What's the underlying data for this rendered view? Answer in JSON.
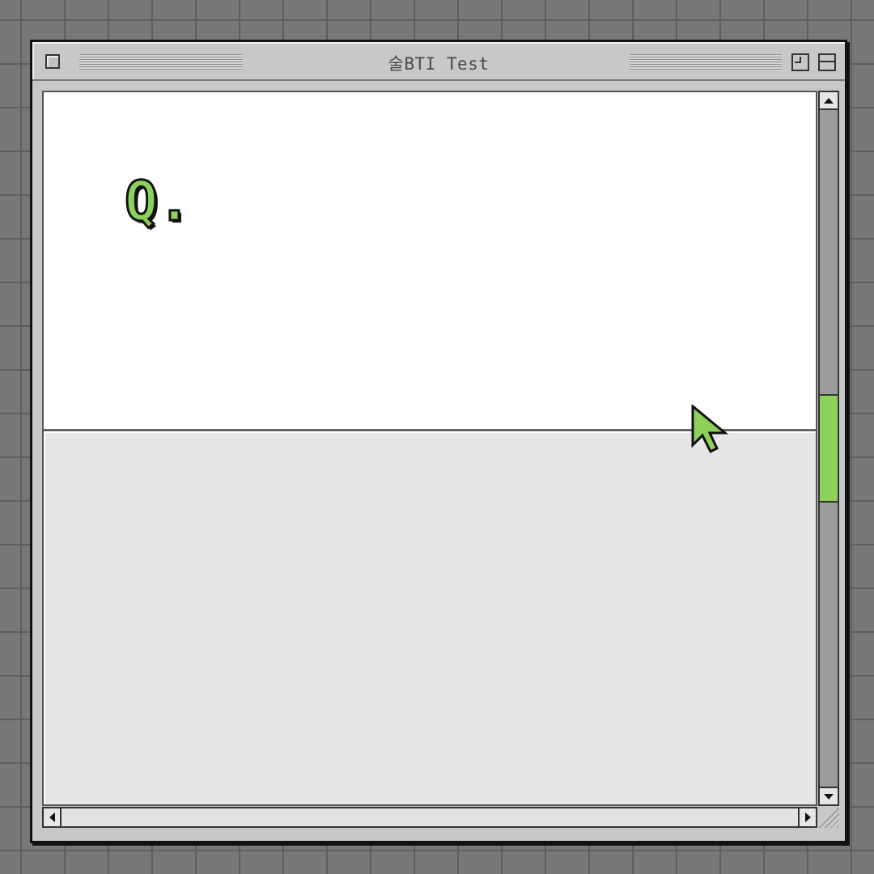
{
  "window": {
    "title": "술BTI Test"
  },
  "question": {
    "label": "Q."
  },
  "answer": {},
  "scrollbar": {
    "vertical_position": 0.5
  },
  "colors": {
    "accent": "#8ed15a",
    "desktop": "#787878",
    "window_chrome": "#c8c8c8",
    "answer_panel": "#e6e6e6"
  },
  "icons": {
    "close": "close-box-icon",
    "zoom": "zoom-box-icon",
    "collapse": "collapse-box-icon",
    "cursor": "mouse-pointer-icon"
  }
}
